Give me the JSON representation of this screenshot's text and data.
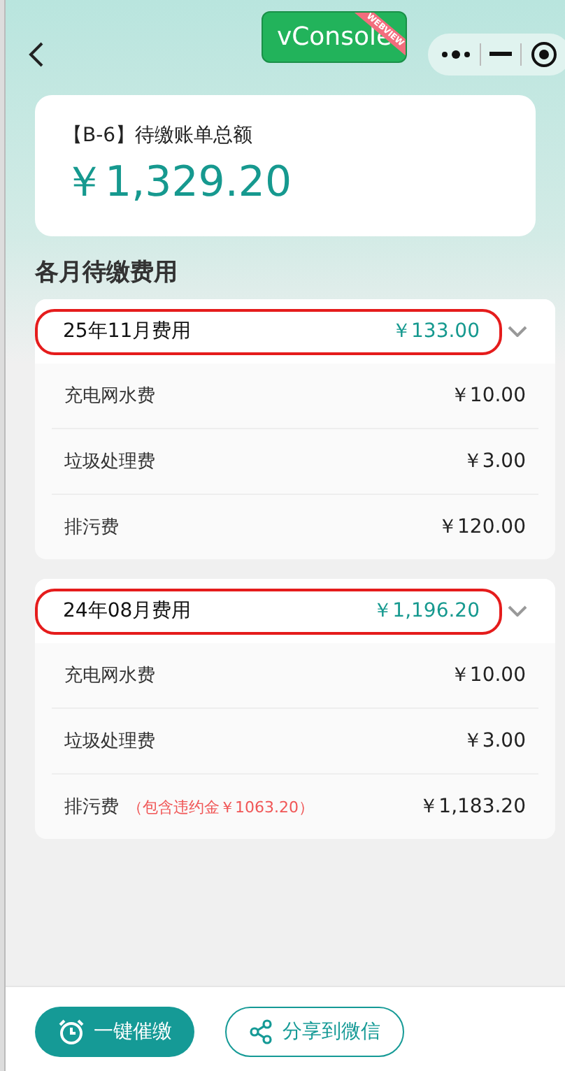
{
  "debug_button": {
    "label": "vConsole",
    "ribbon": "WEBVIEW"
  },
  "summary": {
    "label": "【B-6】待缴账单总额",
    "amount": "￥1,329.20"
  },
  "section_title": "各月待缴费用",
  "months": [
    {
      "title": "25年11月费用",
      "total": "￥133.00",
      "expanded": true,
      "highlighted": true,
      "items": [
        {
          "name": "充电网水费",
          "amount": "￥10.00"
        },
        {
          "name": "垃圾处理费",
          "amount": "￥3.00"
        },
        {
          "name": "排污费",
          "amount": "￥120.00"
        }
      ]
    },
    {
      "title": "24年08月费用",
      "total": "￥1,196.20",
      "expanded": true,
      "highlighted": true,
      "items": [
        {
          "name": "充电网水费",
          "amount": "￥10.00"
        },
        {
          "name": "垃圾处理费",
          "amount": "￥3.00"
        },
        {
          "name": "排污费",
          "note": "（包含违约金￥1063.20）",
          "amount": "￥1,183.20"
        }
      ]
    }
  ],
  "actions": [
    {
      "label": "一键催缴",
      "kind": "primary"
    },
    {
      "label": "分享到微信",
      "kind": "outline"
    }
  ]
}
